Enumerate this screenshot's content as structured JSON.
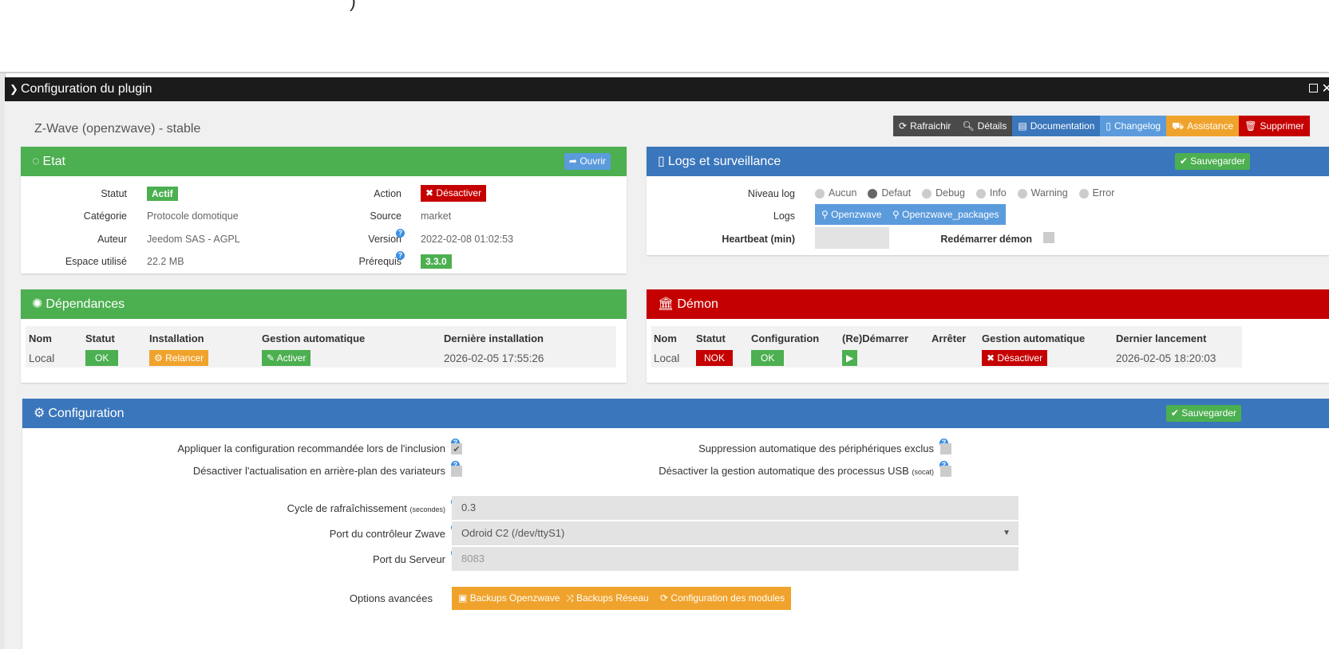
{
  "top": {
    "fragment": ")"
  },
  "modal": {
    "title": "Configuration du plugin"
  },
  "plugin": {
    "name": "Z-Wave (openzwave) - stable"
  },
  "toolbar": {
    "refresh": "Rafraichir",
    "details": "Détails",
    "documentation": "Documentation",
    "changelog": "Changelog",
    "assistance": "Assistance",
    "delete": "Supprimer"
  },
  "etat": {
    "title": "Etat",
    "open_btn": "Ouvrir",
    "statut_label": "Statut",
    "statut": "Actif",
    "categorie_label": "Catégorie",
    "categorie": "Protocole domotique",
    "auteur_label": "Auteur",
    "auteur": "Jeedom SAS - AGPL",
    "espace_label": "Espace utilisé",
    "espace": "22.2 MB",
    "action_label": "Action",
    "action": "Désactiver",
    "source_label": "Source",
    "source": "market",
    "version_label": "Version",
    "version": "2022-02-08 01:02:53",
    "prereq_label": "Prérequis",
    "prereq": "3.3.0"
  },
  "logs": {
    "title": "Logs et surveillance",
    "save": "Sauvegarder",
    "niveau_label": "Niveau log",
    "levels": [
      "Aucun",
      "Defaut",
      "Debug",
      "Info",
      "Warning",
      "Error"
    ],
    "selected_level": "Defaut",
    "logs_label": "Logs",
    "log_openzwave": "Openzwave",
    "log_packages": "Openzwave_packages",
    "heartbeat_label": "Heartbeat (min)",
    "heartbeat_value": "",
    "restart_label": "Redémarrer démon"
  },
  "deps": {
    "title": "Dépendances",
    "headers": [
      "Nom",
      "Statut",
      "Installation",
      "Gestion automatique",
      "Dernière installation"
    ],
    "name": "Local",
    "status": "OK",
    "install_btn": "Relancer",
    "auto_btn": "Activer",
    "last": "2026-02-05 17:55:26"
  },
  "daemon": {
    "title": "Démon",
    "headers": [
      "Nom",
      "Statut",
      "Configuration",
      "(Re)Démarrer",
      "Arrêter",
      "Gestion automatique",
      "Dernier lancement"
    ],
    "name": "Local",
    "status": "NOK",
    "config": "OK",
    "auto_btn": "Désactiver",
    "last": "2026-02-05 18:20:03"
  },
  "config": {
    "title": "Configuration",
    "save": "Sauvegarder",
    "opt1": "Appliquer la configuration recommandée lors de l'inclusion",
    "opt2": "Désactiver l'actualisation en arrière-plan des variateurs",
    "opt3": "Suppression automatique des périphériques exclus",
    "opt4_a": "Désactiver la gestion automatique des processus USB",
    "opt4_b": "(socat)",
    "cycle_label": "Cycle de rafraîchissement",
    "cycle_unit": "(secondes)",
    "cycle_value": "0.3",
    "port_label": "Port du contrôleur Zwave",
    "port_value": "Odroid C2 (/dev/ttyS1)",
    "server_label": "Port du Serveur",
    "server_placeholder": "8083",
    "adv_label": "Options avancées",
    "btn_backup_oz": "Backups Openzwave",
    "btn_backup_net": "Backups Réseau",
    "btn_modules": "Configuration des modules"
  },
  "colors": {
    "green": "#4caf50",
    "blue": "#3a76bb",
    "red": "#c50000",
    "orange": "#f0a32c",
    "lightblue": "#5b9bdc"
  }
}
